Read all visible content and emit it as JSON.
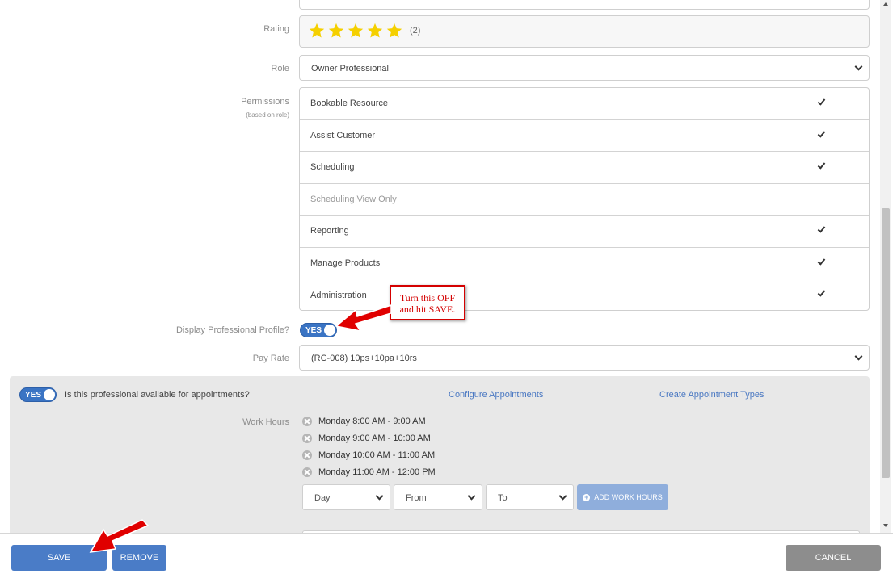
{
  "form": {
    "rating": {
      "label": "Rating",
      "stars": 5,
      "count_text": "(2)"
    },
    "role": {
      "label": "Role",
      "value": "Owner Professional"
    },
    "permissions": {
      "label": "Permissions",
      "sublabel": "(based on role)",
      "items": [
        {
          "label": "Bookable Resource",
          "checked": true
        },
        {
          "label": "Assist Customer",
          "checked": true
        },
        {
          "label": "Scheduling",
          "checked": true
        },
        {
          "label": "Scheduling View Only",
          "checked": false
        },
        {
          "label": "Reporting",
          "checked": true
        },
        {
          "label": "Manage Products",
          "checked": true
        },
        {
          "label": "Administration",
          "checked": true
        }
      ]
    },
    "display_profile": {
      "label": "Display Professional Profile?",
      "toggle": "YES"
    },
    "pay_rate": {
      "label": "Pay Rate",
      "value": "(RC-008) 10ps+10pa+10rs"
    }
  },
  "availability": {
    "toggle": "YES",
    "question": "Is this professional available for appointments?",
    "configure_link": "Configure Appointments",
    "create_link": "Create Appointment Types",
    "work_hours_label": "Work Hours",
    "work_hours": [
      "Monday 8:00 AM - 9:00 AM",
      "Monday 9:00 AM - 10:00 AM",
      "Monday 10:00 AM - 11:00 AM",
      "Monday 11:00 AM - 12:00 PM"
    ],
    "day_select": "Day",
    "from_select": "From",
    "to_select": "To",
    "add_button": "ADD WORK HOURS"
  },
  "footer": {
    "save": "SAVE",
    "remove": "REMOVE",
    "cancel": "CANCEL"
  },
  "annotation": {
    "line1": "Turn this OFF",
    "line2": "and hit SAVE."
  },
  "colors": {
    "accent": "#4a7cc7",
    "annotation": "#d40000",
    "star": "#f5d000"
  }
}
